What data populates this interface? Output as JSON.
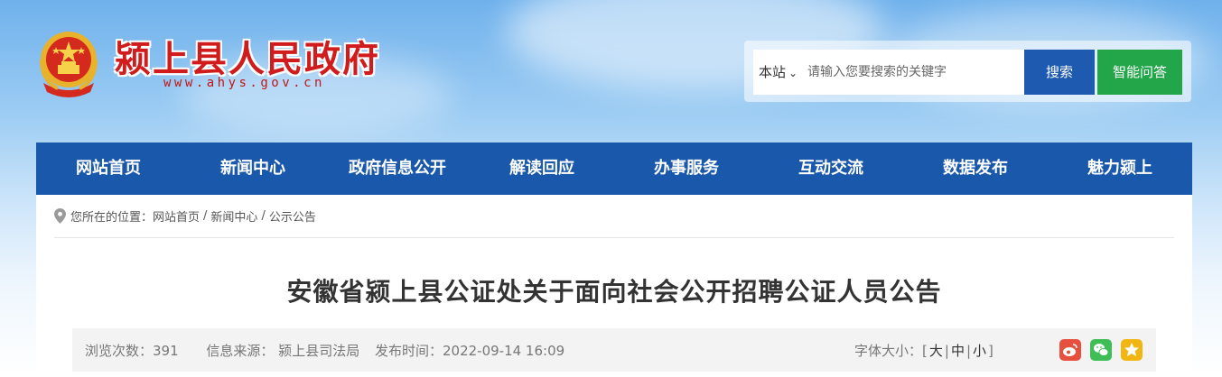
{
  "header": {
    "site_title": "颍上县人民政府",
    "site_url": "www.ahys.gov.cn"
  },
  "search": {
    "scope_label": "本站",
    "placeholder": "请输入您要搜索的关键字",
    "search_button": "搜索",
    "ai_button": "智能问答"
  },
  "nav": {
    "items": [
      {
        "label": "网站首页"
      },
      {
        "label": "新闻中心"
      },
      {
        "label": "政府信息公开"
      },
      {
        "label": "解读回应"
      },
      {
        "label": "办事服务"
      },
      {
        "label": "互动交流"
      },
      {
        "label": "数据发布"
      },
      {
        "label": "魅力颍上"
      }
    ]
  },
  "breadcrumb": {
    "prefix": "您所在的位置：",
    "items": [
      "网站首页",
      "新闻中心",
      "公示公告"
    ],
    "separator": "/"
  },
  "article": {
    "title": "安徽省颍上县公证处关于面向社会公开招聘公证人员公告",
    "views": "浏览次数：391",
    "source": "信息来源：  颍上县司法局",
    "published": "发布时间：2022-09-14 16:09",
    "font_size_label": "字体大小：",
    "font_sizes": [
      "大",
      "中",
      "小"
    ]
  },
  "share": {
    "icons": [
      "weibo-icon",
      "wechat-icon",
      "favorite-icon"
    ]
  },
  "colors": {
    "nav_bg": "#1a58ac",
    "title_red": "#d01c1c",
    "search_blue": "#1e5bb0",
    "ai_green": "#23a54a"
  }
}
